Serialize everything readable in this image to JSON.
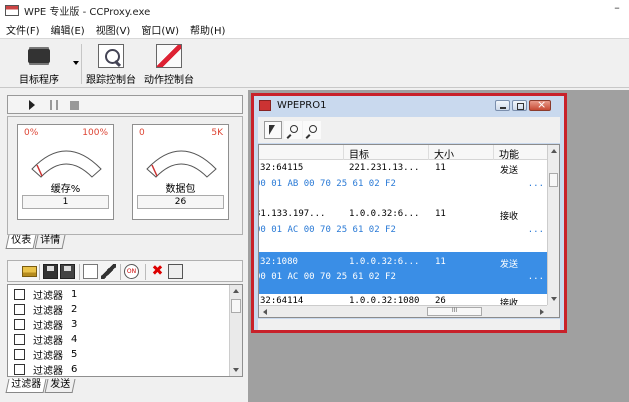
{
  "app": {
    "title": "WPE 专业版 - CCProxy.exe",
    "minimize": "–"
  },
  "menu": [
    "文件(F)",
    "编辑(E)",
    "视图(V)",
    "窗口(W)",
    "帮助(H)"
  ],
  "toolbar": {
    "target": "目标程序",
    "trace": "跟踪控制台",
    "action": "动作控制台"
  },
  "gauges": [
    {
      "min": "0%",
      "max": "100%",
      "label": "缓存%",
      "value": "1",
      "level": 0.01
    },
    {
      "min": "0",
      "max": "5K",
      "label": "数据包",
      "value": "26",
      "level": 0.005
    }
  ],
  "gauge_tabs": [
    "仪表",
    "详情"
  ],
  "filters": [
    {
      "name": "过滤器",
      "num": "1"
    },
    {
      "name": "过滤器",
      "num": "2"
    },
    {
      "name": "过滤器",
      "num": "3"
    },
    {
      "name": "过滤器",
      "num": "4"
    },
    {
      "name": "过滤器",
      "num": "5"
    },
    {
      "name": "过滤器",
      "num": "6"
    }
  ],
  "filter_tabs": [
    "过滤器",
    "发送"
  ],
  "filter_toolbar": {
    "on_label": "ON"
  },
  "wpe": {
    "title": "WPEPRO1",
    "columns": {
      "target": "目标",
      "size": "大小",
      "func": "功能"
    },
    "packets": [
      {
        "src": "32:64115",
        "dst": "221.231.13...",
        "size": "11",
        "func": "发送",
        "hex": "00 01 AB 00 70 25 61 02 F2",
        "dots": "..."
      },
      {
        "src": "31.133.197...",
        "dst": "1.0.0.32:6...",
        "size": "11",
        "func": "接收",
        "hex": "00 01 AC 00 70 25 61 02 F2",
        "dots": "..."
      },
      {
        "src": "32:1080",
        "dst": "1.0.0.32:6...",
        "size": "11",
        "func": "发送",
        "hex": "00 01 AC 00 70 25 61 02 F2",
        "dots": "..."
      },
      {
        "src": "32:64114",
        "dst": "1.0.0.32:1080",
        "size": "26",
        "func": "接收",
        "hex": "",
        "dots": ""
      }
    ],
    "hscroll_grip": "III"
  }
}
